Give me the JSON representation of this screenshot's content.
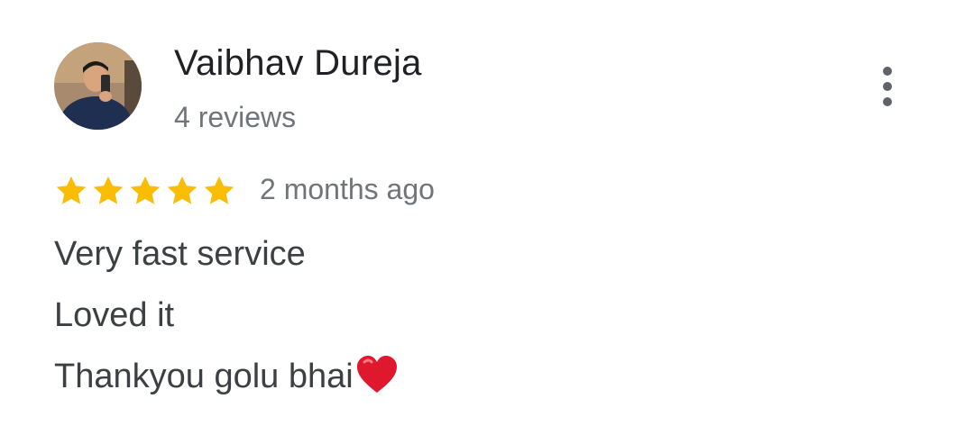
{
  "review": {
    "author_name": "Vaibhav Dureja",
    "review_count": "4 reviews",
    "rating": 5,
    "rating_max": 5,
    "time_ago": "2 months ago",
    "text_lines": [
      "Very fast service",
      "Loved it",
      "Thankyou golu bhai"
    ],
    "emoji": "heart-emoji"
  },
  "colors": {
    "star": "#fbbc04",
    "name": "#202124",
    "secondary": "#70757a",
    "body": "#3c4043",
    "heart": "#e0182d"
  },
  "icons": {
    "menu": "more-vert-icon",
    "star": "star-icon"
  }
}
